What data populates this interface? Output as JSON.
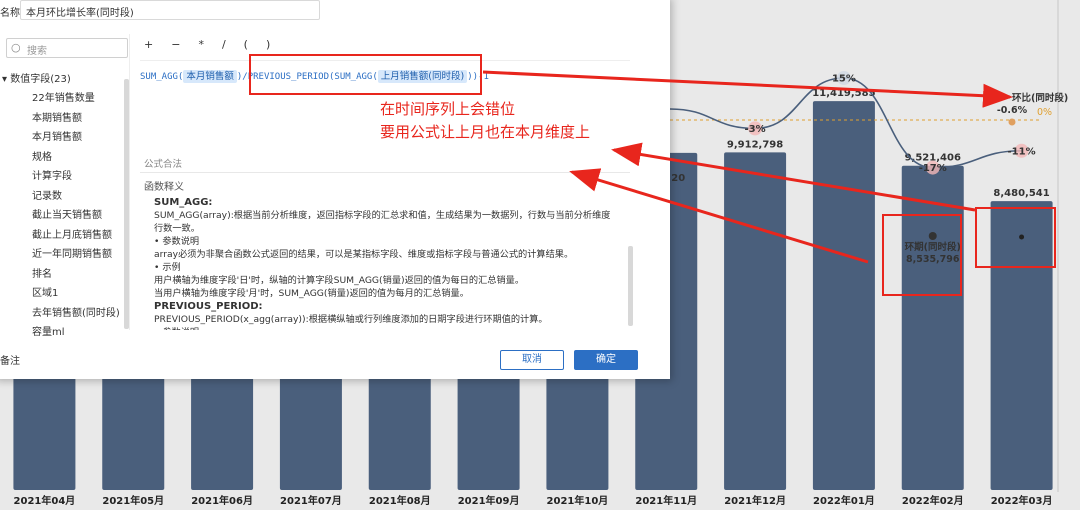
{
  "dialog": {
    "name_label": "名称",
    "name_value": "本月环比增长率(同时段)",
    "search_placeholder": "搜索",
    "field_group_label": "数值字段(23)",
    "fields": [
      "22年销售数量",
      "本期销售额",
      "本月销售额",
      "规格",
      "计算字段",
      "记录数",
      "截止当天销售额",
      "截止上月底销售额",
      "近一年同期销售额",
      "排名",
      "区域1",
      "去年销售额(同时段)",
      "容量ml"
    ],
    "operators": [
      "+",
      "−",
      "*",
      "/",
      "(",
      ")"
    ],
    "formula": {
      "fn1": "SUM_AGG(",
      "chip1": "本月销售额",
      "mid": ")/PREVIOUS_PERIOD(SUM_AGG(",
      "chip2": "上月销售额(同时段)",
      "tail": "))-1"
    },
    "valid_text": "公式合法",
    "help_title": "函数释义",
    "help_lines": [
      "SUM_AGG:",
      "SUM_AGG(array):根据当前分析维度，返回指标字段的汇总求和值，生成结果为一数据列，行数与当前分析维度行数一致。",
      "• 参数说明",
      "array必须为非聚合函数公式返回的结果，可以是某指标字段、维度或指标字段与普通公式的计算结果。",
      "• 示例",
      "用户横轴为维度字段'日'时，纵轴的计算字段SUM_AGG(销量)返回的值为每日的汇总销量。",
      "当用户横轴为维度字段'月'时，SUM_AGG(销量)返回的值为每月的汇总销量。",
      "PREVIOUS_PERIOD:",
      "PREVIOUS_PERIOD(x_agg(array)):根据横纵轴或行列维度添加的日期字段进行环期值的计算。",
      "• 参数说明"
    ],
    "remark_label": "备注",
    "cancel_label": "取消",
    "ok_label": "确定"
  },
  "annotation": {
    "line1": "在时间序列上会错位",
    "line2": "要用公式让上月也在本月维度上",
    "color": "#e8261d"
  },
  "chart_data": {
    "type": "bar",
    "categories": [
      "2021年04月",
      "2021年05月",
      "2021年06月",
      "2021年07月",
      "2021年08月",
      "2021年09月",
      "2021年10月",
      "2021年11月",
      "2021年12月",
      "2022年01月",
      "2022年02月",
      "2022年03月"
    ],
    "bar_color": "#4a5f7c",
    "visible_labels": {
      "2021年12月": "9,912,798",
      "2022年01月": "11,419,585",
      "2022年02月": "9,521,406",
      "2022年03月": "8,480,541"
    },
    "partial_label_nov": "20",
    "line_series": {
      "name": "环比(同时段)",
      "visible_values": {
        "2021年12月": "-3%",
        "2022年01月": "15%",
        "2022年02月": "-17%",
        "2022年03月": "-11%"
      },
      "last_label": "-0.6%",
      "zero_label": "0%"
    },
    "secondary_series_name": "环期(同时段)",
    "secondary_value_feb": "8,535,796"
  }
}
